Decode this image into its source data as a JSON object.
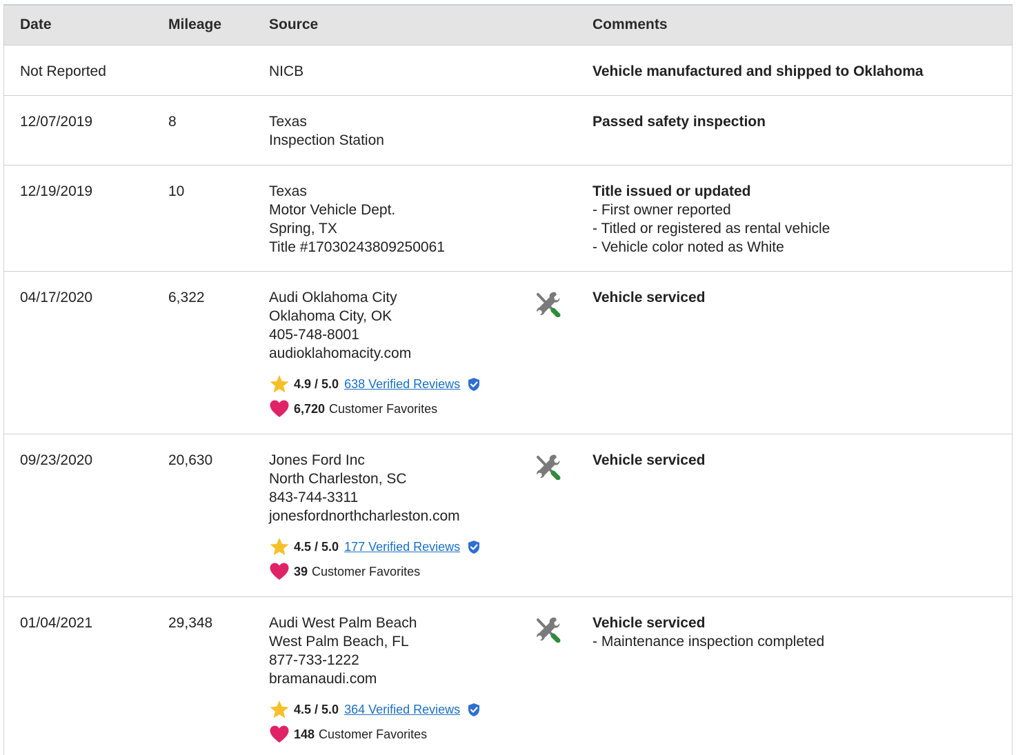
{
  "columns": {
    "date": "Date",
    "mileage": "Mileage",
    "source": "Source",
    "comments": "Comments"
  },
  "icons": {
    "service": "wrench-screwdriver-icon",
    "rating": "star-icon",
    "verified": "verified-shield-icon",
    "favorites": "heart-icon"
  },
  "colors": {
    "header_bg": "#e4e4e4",
    "link": "#1a6fc4",
    "star": "#f5c02a",
    "heart": "#e02366",
    "wrench_green": "#2e8b3a",
    "verified_blue": "#2f6fd0"
  },
  "rows": [
    {
      "date": "Not Reported",
      "mileage": "",
      "source": [
        "NICB"
      ],
      "comment_title": "Vehicle manufactured and shipped to Oklahoma",
      "comment_lines": []
    },
    {
      "date": "12/07/2019",
      "mileage": "8",
      "source": [
        "Texas",
        "Inspection Station"
      ],
      "comment_title": "Passed safety inspection",
      "comment_lines": []
    },
    {
      "date": "12/19/2019",
      "mileage": "10",
      "source": [
        "Texas",
        "Motor Vehicle Dept.",
        "Spring, TX",
        "Title #17030243809250061"
      ],
      "comment_title": "Title issued or updated",
      "comment_lines": [
        "- First owner reported",
        "- Titled or registered as rental vehicle",
        "- Vehicle color noted as White"
      ]
    },
    {
      "date": "04/17/2020",
      "mileage": "6,322",
      "source": [
        "Audi Oklahoma City",
        "Oklahoma City, OK",
        "405-748-8001",
        "audioklahomacity.com"
      ],
      "rating": "4.9 / 5.0",
      "reviews": "638 Verified Reviews",
      "favorites": "6,720",
      "favorites_label": "Customer Favorites",
      "comment_title": "Vehicle serviced",
      "comment_lines": []
    },
    {
      "date": "09/23/2020",
      "mileage": "20,630",
      "source": [
        "Jones Ford Inc",
        "North Charleston, SC",
        "843-744-3311",
        "jonesfordnorthcharleston.com"
      ],
      "rating": "4.5 / 5.0",
      "reviews": "177 Verified Reviews",
      "favorites": "39",
      "favorites_label": "Customer Favorites",
      "comment_title": "Vehicle serviced",
      "comment_lines": []
    },
    {
      "date": "01/04/2021",
      "mileage": "29,348",
      "source": [
        "Audi West Palm Beach",
        "West Palm Beach, FL",
        "877-733-1222",
        "bramanaudi.com"
      ],
      "rating": "4.5 / 5.0",
      "reviews": "364 Verified Reviews",
      "favorites": "148",
      "favorites_label": "Customer Favorites",
      "comment_title": "Vehicle serviced",
      "comment_lines": [
        "- Maintenance inspection completed"
      ]
    }
  ]
}
